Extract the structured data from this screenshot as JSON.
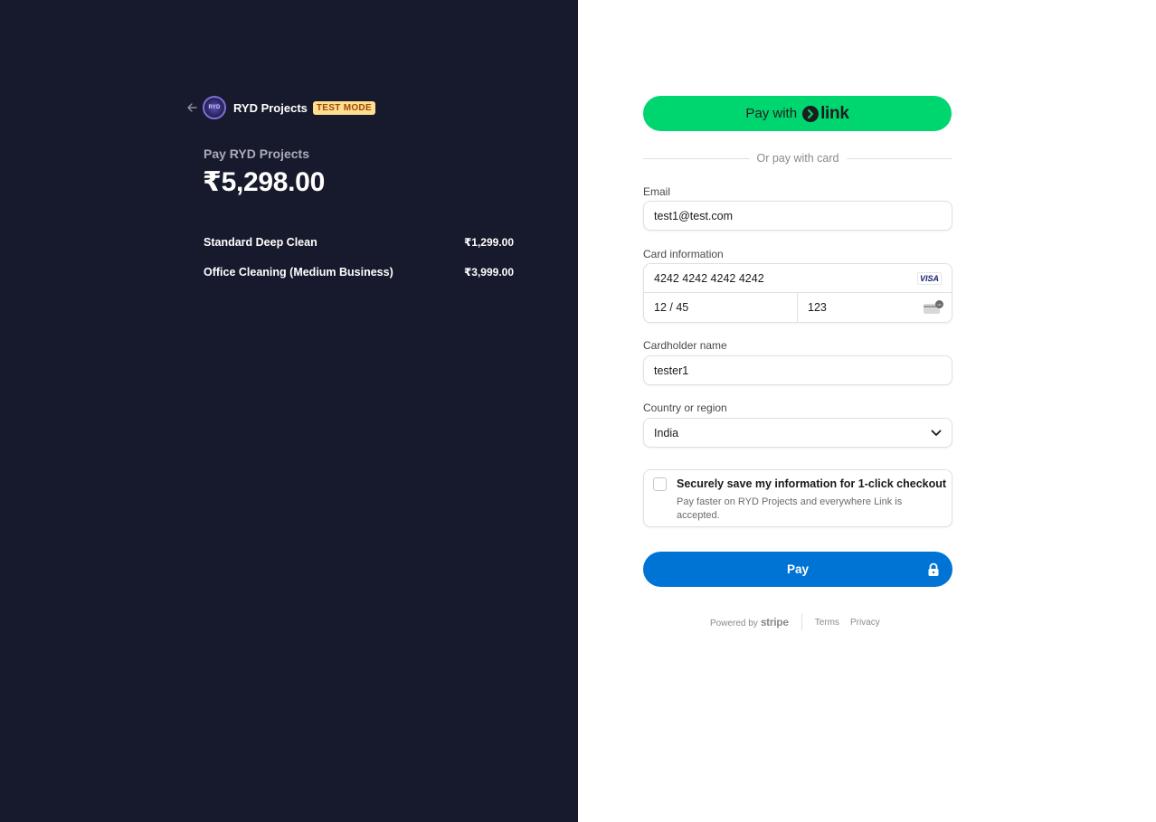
{
  "merchant": {
    "name": "RYD Projects",
    "logo_text": "RYD",
    "test_badge": "TEST MODE",
    "pay_label": "Pay RYD Projects",
    "total": "₹5,298.00"
  },
  "line_items": [
    {
      "name": "Standard Deep Clean",
      "price": "₹1,299.00"
    },
    {
      "name": "Office Cleaning (Medium Business)",
      "price": "₹3,999.00"
    }
  ],
  "link_button": {
    "prefix": "Pay with",
    "brand": "link"
  },
  "divider_text": "Or pay with card",
  "email": {
    "label": "Email",
    "value": "test1@test.com"
  },
  "card": {
    "label": "Card information",
    "number": "4242 4242 4242 4242",
    "brand": "VISA",
    "expiry": "12 / 45",
    "cvc": "123"
  },
  "cardholder": {
    "label": "Cardholder name",
    "value": "tester1"
  },
  "country": {
    "label": "Country or region",
    "value": "India"
  },
  "save_info": {
    "title": "Securely save my information for 1-click checkout",
    "subtitle": "Pay faster on RYD Projects and everywhere Link is accepted."
  },
  "pay_button": {
    "label": "Pay"
  },
  "footer": {
    "powered_by": "Powered by",
    "brand": "stripe",
    "terms": "Terms",
    "privacy": "Privacy"
  },
  "colors": {
    "left_bg": "#171a2c",
    "link_green": "#00d66f",
    "pay_blue": "#0074d4",
    "badge_bg": "#ffde92",
    "badge_text": "#a04a00"
  }
}
